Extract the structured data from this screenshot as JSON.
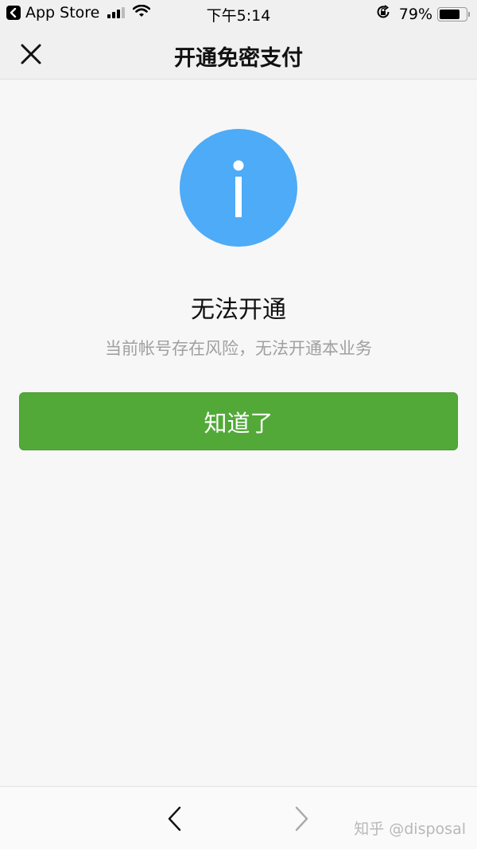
{
  "status_bar": {
    "back_app": "App Store",
    "time": "下午5:14",
    "battery_percent": "79%",
    "battery_level": 0.79,
    "signal_bars_active": 3,
    "signal_bars_total": 4,
    "icons": [
      "back-app-icon",
      "signal-icon",
      "wifi-icon",
      "rotation-lock-icon",
      "battery-icon"
    ]
  },
  "nav_bar": {
    "title": "开通免密支付",
    "close_icon": "close-icon"
  },
  "content": {
    "icon": "info-icon",
    "icon_color": "#4dabf7",
    "title": "无法开通",
    "description": "当前帐号存在风险，无法开通本业务",
    "button_label": "知道了",
    "button_color": "#52a938"
  },
  "bottom_bar": {
    "back_icon": "chevron-left-icon",
    "forward_icon": "chevron-right-icon",
    "watermark": "知乎 @disposal"
  }
}
